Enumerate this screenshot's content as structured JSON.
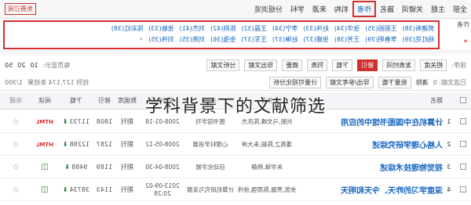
{
  "filter_tabs": [
    "全部",
    "主题",
    "关键词",
    "篇名",
    "作者",
    "机构",
    "来源",
    "学科",
    "分组浏览"
  ],
  "filter_tabs_active_index": 4,
  "filter_right_link": "免费订阅",
  "filter_label": "作者",
  "filter_side_mark": "»",
  "authors_row1": [
    "郭建新(38)",
    "王丽丽(35)",
    "张华(34)",
    "赵伟(33)",
    "李宁(34)",
    "王磊(32)",
    "陈刚(42)",
    "刘杰(41)",
    "张敏(33)",
    "陈彩红(38)"
  ],
  "authors_row2": [
    "杨红花(39)",
    "李春明(39)",
    "王芳(38)",
    "张娜(37)",
    "赵琳(37)",
    "王军(37)",
    "张强(36)",
    "刘燕(35)",
    "刘伟(35)",
    "»"
  ],
  "toolbar1": {
    "sort_label": "排序:",
    "sort_options": [
      "相关度",
      "发表时间",
      "被引",
      "下载"
    ],
    "active_sort": "被引",
    "view_list": "列表",
    "view_abstract": "摘要",
    "export_label": "导出文献",
    "analyze_label": "分析文献",
    "page_size_label": "每页显示:",
    "page_sizes": [
      "10",
      "20",
      "50"
    ]
  },
  "toolbar2": {
    "selected_label": "已选文献: 0",
    "clear_label": "清除",
    "batch_download": "批量下载",
    "export_refs": "导出/参考文献",
    "visual_analysis": "计量可视化分析",
    "result_count": "找到 127,174 条结果",
    "page_indicator": "1/300"
  },
  "table_headers": [
    "",
    "",
    "题名",
    "作者",
    "来源",
    "发表时间",
    "数据库",
    "被引",
    "下载",
    "阅读",
    "收藏"
  ],
  "rows": [
    {
      "no": "1",
      "title": "计算机在中国图书馆中的应用",
      "author": "刘新,马文峰,陈庆杰",
      "source": "图书馆学刊",
      "date": "2008-01-18",
      "db": "期刊",
      "cite": "1808",
      "download": "11733",
      "read_type": "HTML",
      "fav": "☆"
    },
    {
      "no": "2",
      "title": "人格心理学研究综述",
      "author": "潘燕之,陈毅,朱大岸",
      "source": "心理科学进展",
      "date": "2008-05-12",
      "db": "期刊",
      "cite": "1287",
      "download": "12288",
      "read_type": "HTML",
      "fav": "☆"
    },
    {
      "no": "3",
      "title": "视觉物理技术综述",
      "author": "朱学锋,杨静",
      "source": "自动化学报",
      "date": "2008-04-30",
      "db": "期刊",
      "cite": "1189",
      "download": "9488",
      "read_type": "BOOK",
      "fav": "☆"
    },
    {
      "no": "4",
      "title": "深度学习的昨天、今天和明天",
      "author": "余凯,贾磊,陈雨强,徐伟",
      "source": "计算机研究与发展",
      "date": "2013-09-02 20:28",
      "db": "期刊",
      "cite": "1143",
      "download": "38734",
      "read_type": "BOOK",
      "fav": "☆"
    }
  ],
  "caption": "学科背景下的文献筛选",
  "colors": {
    "accent_red": "#d32f2f",
    "link_blue": "#1565c0",
    "download_green": "#2e7d32"
  }
}
